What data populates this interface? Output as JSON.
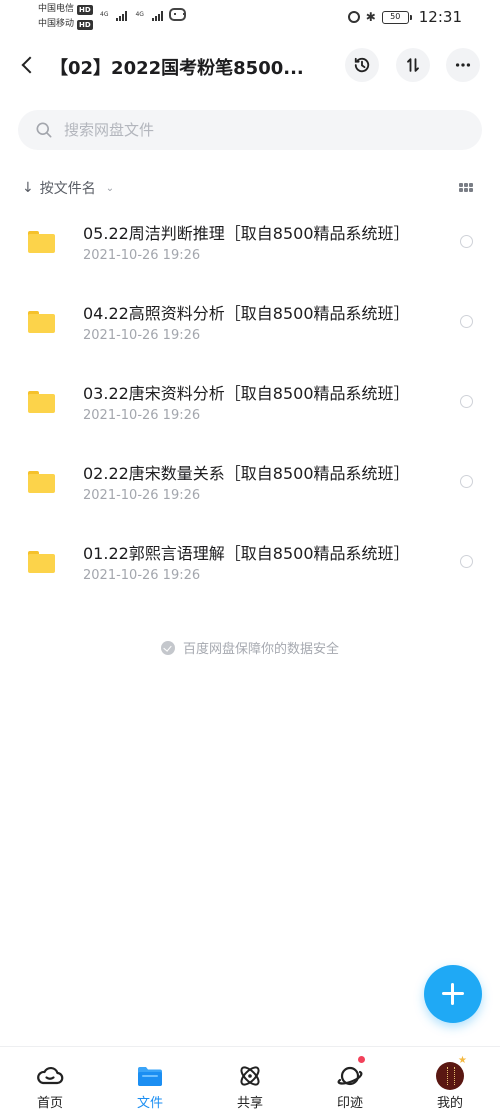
{
  "status_bar": {
    "carrier1": "中国电信",
    "carrier2": "中国移动",
    "hd_badge": "HD",
    "network1": "4G",
    "network2": "4G",
    "battery": "50",
    "time": "12:31"
  },
  "header": {
    "title": "【02】2022国考粉笔8500..."
  },
  "search": {
    "placeholder": "搜索网盘文件"
  },
  "sort": {
    "label": "按文件名"
  },
  "files": [
    {
      "name": "05.22周洁判断推理［取自8500精品系统班］",
      "date": "2021-10-26  19:26"
    },
    {
      "name": "04.22高照资料分析［取自8500精品系统班］",
      "date": "2021-10-26  19:26"
    },
    {
      "name": "03.22唐宋资料分析［取自8500精品系统班］",
      "date": "2021-10-26  19:26"
    },
    {
      "name": "02.22唐宋数量关系［取自8500精品系统班］",
      "date": "2021-10-26  19:26"
    },
    {
      "name": "01.22郭熙言语理解［取自8500精品系统班］",
      "date": "2021-10-26  19:26"
    }
  ],
  "safety_note": "百度网盘保障你的数据安全",
  "bottom_nav": [
    {
      "label": "首页",
      "icon": "home-cloud-icon"
    },
    {
      "label": "文件",
      "icon": "folder-icon",
      "active": true
    },
    {
      "label": "共享",
      "icon": "share-atom-icon"
    },
    {
      "label": "印迹",
      "icon": "planet-icon",
      "badge": true
    },
    {
      "label": "我的",
      "icon": "avatar"
    }
  ],
  "colors": {
    "accent": "#1b8ef2",
    "fab": "#1fa9f5",
    "folder": "#fcd34a",
    "badge": "#f2415a"
  }
}
